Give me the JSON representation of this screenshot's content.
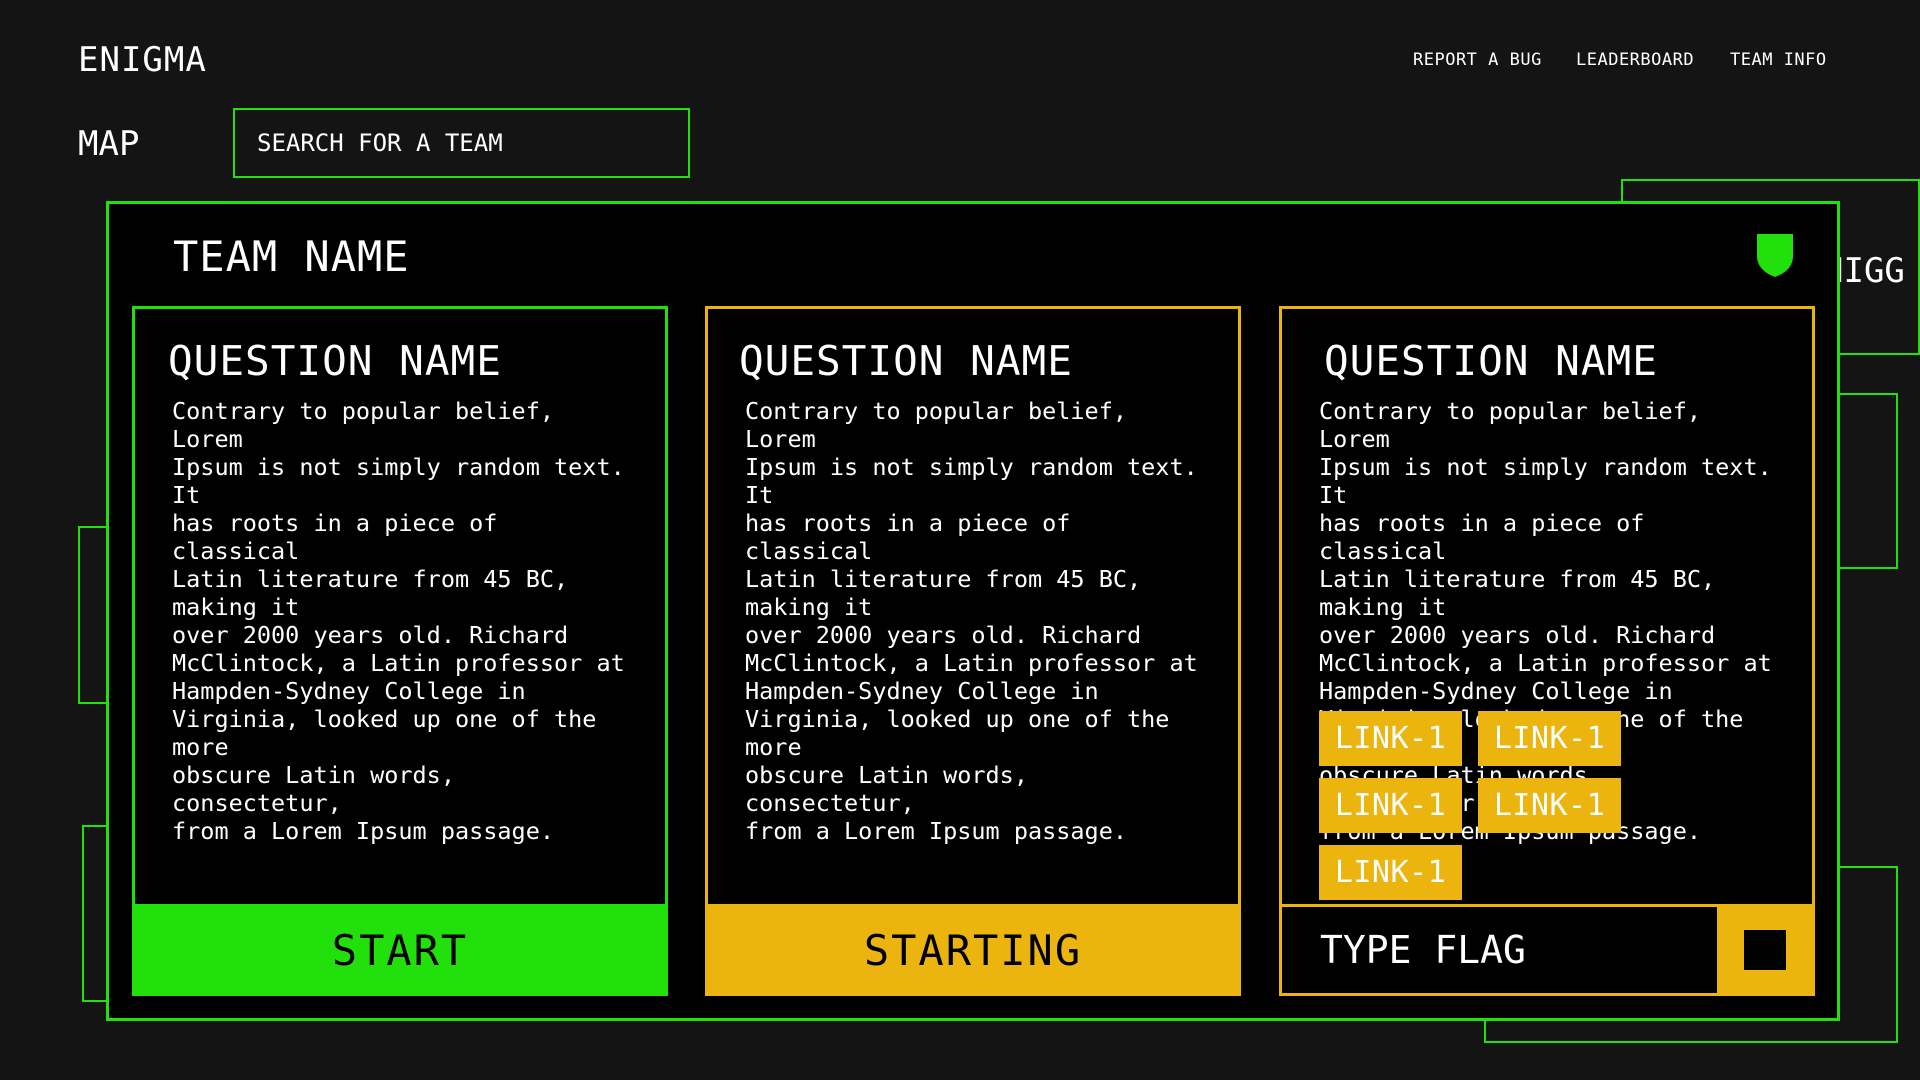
{
  "app": {
    "title": "ENIGMA"
  },
  "nav": {
    "report_bug": "REPORT A BUG",
    "leaderboard": "LEADERBOARD",
    "team_info": "TEAM INFO"
  },
  "map": {
    "label": "MAP",
    "search_placeholder": "SEARCH FOR A TEAM",
    "partial_team_text": "NIGG"
  },
  "modal": {
    "team_name": "TEAM NAME",
    "shield_icon": "shield-icon",
    "cards": [
      {
        "title": "QUESTION NAME",
        "body": "Contrary to popular belief, Lorem\nIpsum is not simply random text. It\nhas roots in a piece of classical\nLatin literature from 45 BC, making it\nover 2000 years old. Richard\nMcClintock, a Latin professor at\nHampden-Sydney College in\nVirginia, looked up one of the more\nobscure Latin words, consectetur,\nfrom a Lorem Ipsum passage.",
        "button": "START",
        "state": "green"
      },
      {
        "title": "QUESTION NAME",
        "body": "Contrary to popular belief, Lorem\nIpsum is not simply random text. It\nhas roots in a piece of classical\nLatin literature from 45 BC, making it\nover 2000 years old. Richard\nMcClintock, a Latin professor at\nHampden-Sydney College in\nVirginia, looked up one of the more\nobscure Latin words, consectetur,\nfrom a Lorem Ipsum passage.",
        "button": "STARTING",
        "state": "yellow"
      },
      {
        "title": "QUESTION NAME",
        "body": "Contrary to popular belief, Lorem\nIpsum is not simply random text. It\nhas roots in a piece of classical\nLatin literature from 45 BC, making it\nover 2000 years old. Richard\nMcClintock, a Latin professor at\nHampden-Sydney College in\nVirginia, looked up one of the more\nobscure Latin words, consectetur,\nfrom a Lorem Ipsum passage.",
        "links": [
          "LINK-1",
          "LINK-1",
          "LINK-1",
          "LINK-1",
          "LINK-1"
        ],
        "flag_placeholder": "TYPE FLAG",
        "state": "yellow"
      }
    ]
  },
  "colors": {
    "background": "#141414",
    "accent_green": "#22e00c",
    "accent_yellow": "#ebb40e",
    "panel": "#000000"
  }
}
